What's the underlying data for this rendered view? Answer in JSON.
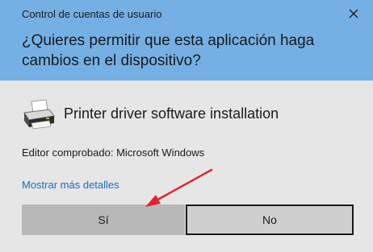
{
  "window": {
    "title": "Control de cuentas de usuario"
  },
  "header": {
    "question": "¿Quieres permitir que esta aplicación haga cambios en el dispositivo?"
  },
  "app": {
    "icon": "printer-icon",
    "name": "Printer driver software installation",
    "publisher": "Editor comprobado: Microsoft Windows"
  },
  "details_link": "Mostrar más detalles",
  "buttons": {
    "yes_label": "Sí",
    "no_label": "No"
  },
  "colors": {
    "header_bg": "#75b0e4",
    "dialog_bg": "#e6e6e6",
    "link": "#1a6dbd",
    "annotation_arrow": "#e0262a"
  }
}
